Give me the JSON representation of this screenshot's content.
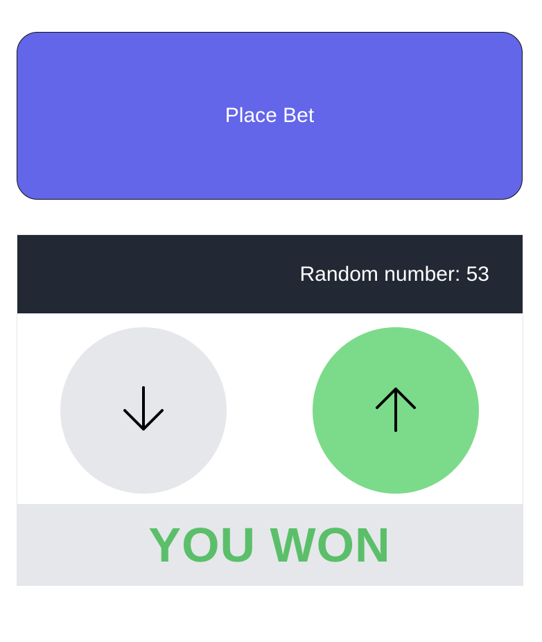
{
  "place_bet": {
    "label": "Place Bet",
    "color": "#6366e9"
  },
  "header": {
    "random_number_text": "Random number: 53"
  },
  "controls": {
    "down_icon": "arrow-down-icon",
    "up_icon": "arrow-up-icon",
    "down_bg": "#e5e7eb",
    "up_bg": "#7bdb8a"
  },
  "result": {
    "text": "YOU WON",
    "color": "#5bbf69"
  }
}
